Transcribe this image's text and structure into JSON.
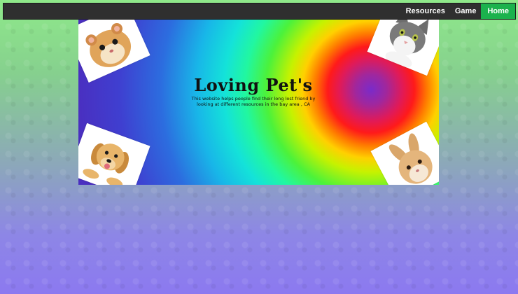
{
  "nav": {
    "items": [
      {
        "label": "Resources"
      },
      {
        "label": "Game"
      },
      {
        "label": "Home",
        "active": true
      }
    ],
    "active_color": "#1bb24d",
    "background": "#2f2f2f"
  },
  "hero": {
    "title": "Loving Pet's",
    "description": "This website helps people find their long lost friend by looking at different resources in the bay area , CA",
    "photos": [
      "hamster-photo",
      "cat-photo",
      "puppy-photo",
      "rabbit-photo"
    ]
  }
}
